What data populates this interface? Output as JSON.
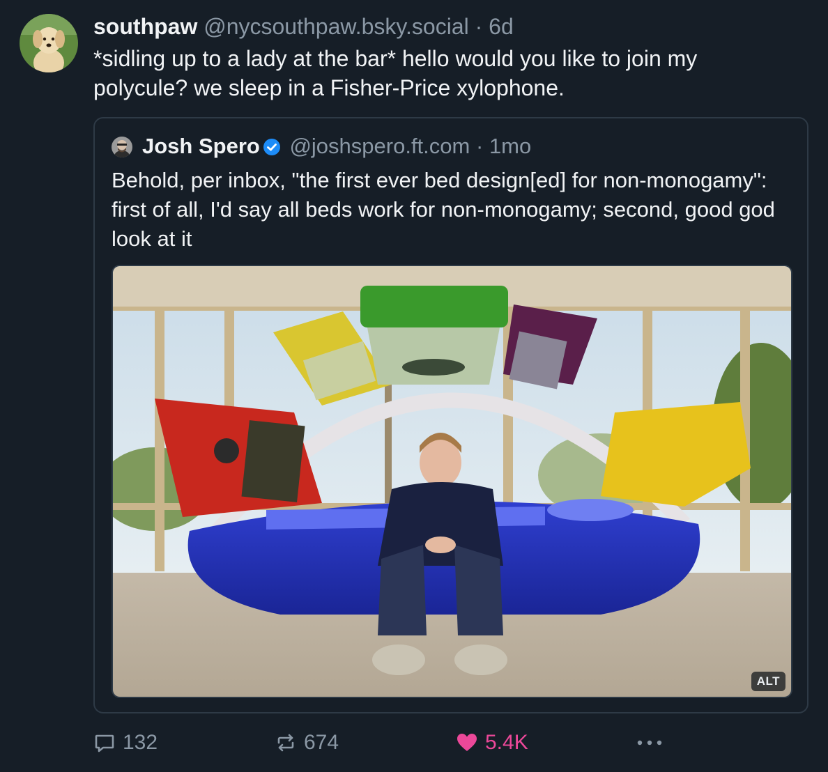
{
  "post": {
    "display_name": "southpaw",
    "handle": "@nycsouthpaw.bsky.social",
    "separator": "·",
    "time": "6d",
    "text": "*sidling up to a lady at the bar* hello would you like to join my polycule? we sleep in a Fisher-Price xylophone."
  },
  "quote": {
    "display_name": "Josh Spero",
    "handle": "@joshspero.ft.com",
    "separator": "·",
    "time": "1mo",
    "text": "Behold, per inbox, \"the first ever bed design[ed] for non-monogamy\": first of all, I'd say all beds work for non-monogamy; second, good god look at it",
    "image_alt_badge": "ALT"
  },
  "actions": {
    "reply_count": "132",
    "repost_count": "674",
    "like_count": "5.4K"
  },
  "colors": {
    "background": "#161e27",
    "muted": "#8b98a5",
    "like": "#ec4899",
    "verified": "#1d8cf8"
  },
  "icons": [
    "reply-icon",
    "repost-icon",
    "heart-icon",
    "more-icon",
    "verified-badge-icon"
  ]
}
